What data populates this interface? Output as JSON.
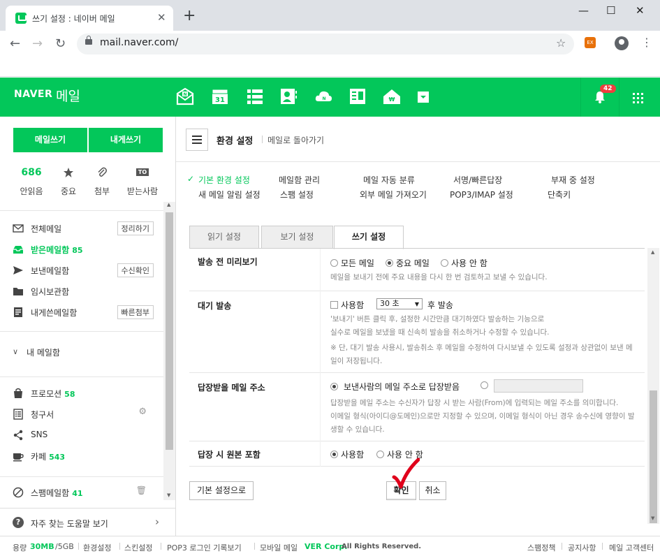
{
  "browser": {
    "tab_title": "쓰기 설정 : 네이버 메일",
    "url": "mail.naver.com/",
    "new_tab": "+",
    "ext_label": "EX"
  },
  "header": {
    "logo": "NAVER",
    "logo_sub": "메일",
    "apps": [
      "mail-icon",
      "calendar-icon",
      "contacts-list-icon",
      "address-book-icon",
      "cloud-icon",
      "memo-icon",
      "home-icon",
      "more-icon"
    ],
    "calendar_day": "31",
    "notification_count": "42",
    "accent": "#03c75a"
  },
  "sidebar": {
    "compose": "메일쓰기",
    "compose_self": "내게쓰기",
    "quick": [
      {
        "value": "686",
        "label": "안읽음"
      },
      {
        "value": "",
        "label": "중요"
      },
      {
        "value": "",
        "label": "첨부"
      },
      {
        "value": "TO",
        "label": "받는사람"
      }
    ],
    "items": [
      {
        "label": "전체메일",
        "count": "",
        "tag": "정리하기"
      },
      {
        "label": "받은메일함",
        "count": "85",
        "tag": ""
      },
      {
        "label": "보낸메일함",
        "count": "",
        "tag": "수신확인"
      },
      {
        "label": "임시보관함",
        "count": "",
        "tag": ""
      },
      {
        "label": "내게쓴메일함",
        "count": "",
        "tag": "빠른첨부"
      }
    ],
    "my_mailbox": "내 메일함",
    "extra": [
      {
        "label": "프로모션",
        "count": "58"
      },
      {
        "label": "청구서",
        "count": ""
      },
      {
        "label": "SNS",
        "count": ""
      },
      {
        "label": "카페",
        "count": "543"
      }
    ],
    "spam": {
      "label": "스팸메일함",
      "count": "41"
    },
    "help": "자주 찾는 도움말 보기"
  },
  "main": {
    "title": "환경 설정",
    "back": "메일로 돌아가기",
    "nav_row1": [
      "기본 환경 설정",
      "메일함 관리",
      "메일 자동 분류",
      "서명/빠른답장",
      "부재 중 설정"
    ],
    "nav_row2": [
      "새 메일 알림 설정",
      "스팸 설정",
      "외부 메일 가져오기",
      "POP3/IMAP 설정",
      "단축키"
    ],
    "tabs": [
      "읽기 설정",
      "보기 설정",
      "쓰기 설정"
    ],
    "rows": {
      "preview": {
        "label": "발송 전 미리보기",
        "options": [
          "모든 메일",
          "중요 메일",
          "사용 안 함"
        ],
        "selected": 1,
        "help": "메일을 보내기 전에 주요 내용을 다시 한 번 검토하고 보낼 수 있습니다."
      },
      "delay": {
        "label": "대기 발송",
        "checkbox": "사용함",
        "select": "30 초",
        "suffix": "후 발송",
        "help1": "'보내기' 버튼 클릭 후, 설정한 시간만큼 대기하였다 발송하는 기능으로",
        "help2": "실수로 메일을 보냈을 때 신속히 발송을 취소하거나 수정할 수 있습니다.",
        "help3": "※ 단, 대기 발송 사용시, 발송취소 후 메일을 수정하여 다시보낼 수 있도록 설정과 상관없이 보낸 메",
        "help4": "일이 저장됩니다."
      },
      "reply_to": {
        "label": "답장받을 메일 주소",
        "option1": "보낸사람의 메일 주소로 답장받음",
        "help1": "답장받을 메일 주소는 수신자가 답장 시 받는 사람(From)에 입력되는 메일 주소를 의미합니다.",
        "help2": "이메일 형식(아이디@도메인)으로만 지정할 수 있으며, 이메일 형식이 아닌 경우 송수신에 영향이 발",
        "help3": "생할 수 있습니다."
      },
      "quote": {
        "label": "답장 시 원본 포함",
        "options": [
          "사용함",
          "사용 안 함"
        ],
        "selected": 0
      }
    },
    "buttons": {
      "reset": "기본 설정으로",
      "confirm": "확인",
      "cancel": "취소"
    }
  },
  "status": {
    "usage_label": "용량",
    "used": "30MB",
    "total": "/5GB",
    "links": [
      "환경설정",
      "스킨설정",
      "POP3 로그인 기록보기",
      "모바일 메일"
    ],
    "copyright_brand": "VER Corp.",
    "copyright": "All Rights Reserved.",
    "right_links": [
      "스팸정책",
      "공지사항",
      "메일 고객센터"
    ]
  }
}
